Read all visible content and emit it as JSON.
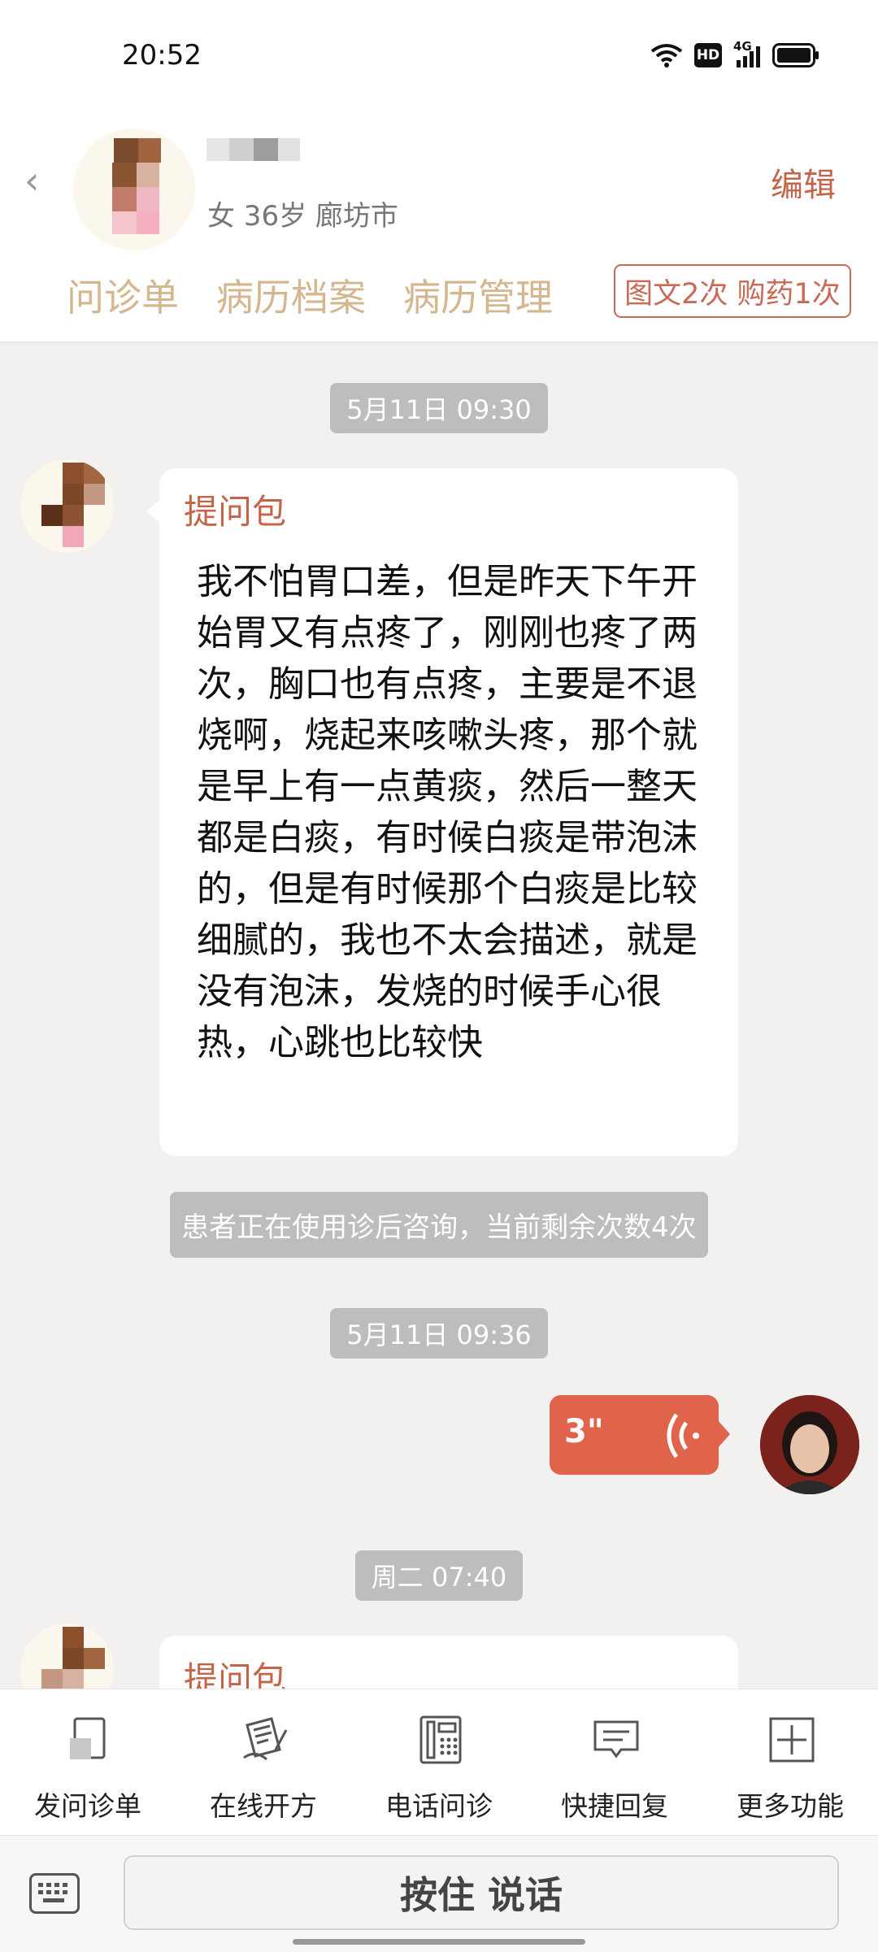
{
  "status_bar": {
    "time": "20:52",
    "hd": "HD",
    "network": "4G"
  },
  "header": {
    "patient_info": "女 36岁  廊坊市",
    "edit_label": "编辑",
    "tabs": [
      "问诊单",
      "病历档案",
      "病历管理"
    ],
    "service_badge": "图文2次 购药1次"
  },
  "chat": {
    "time1": "5月11日 09:30",
    "msg1_title": "提问包",
    "msg1_body": "我不怕胃口差，但是昨天下午开始胃又有点疼了，刚刚也疼了两次，胸口也有点疼，主要是不退烧啊，烧起来咳嗽头疼，那个就是早上有一点黄痰，然后一整天都是白痰，有时候白痰是带泡沫的，但是有时候那个白痰是比较细腻的，我也不太会描述，就是没有泡沫，发烧的时候手心很热，心跳也比较快",
    "system_notice": "患者正在使用诊后咨询，当前剩余次数4次",
    "time2": "5月11日 09:36",
    "voice_duration": "3\"",
    "time3": "周二 07:40",
    "msg2_title": "提问包"
  },
  "toolbar": {
    "items": [
      {
        "label": "发问诊单",
        "icon": "questionnaire-icon"
      },
      {
        "label": "在线开方",
        "icon": "prescription-icon"
      },
      {
        "label": "电话问诊",
        "icon": "phone-icon"
      },
      {
        "label": "快捷回复",
        "icon": "quick-reply-icon"
      },
      {
        "label": "更多功能",
        "icon": "plus-icon"
      }
    ]
  },
  "input": {
    "hold_to_talk": "按住 说话"
  },
  "colors": {
    "accent": "#c4654a",
    "voice_bubble": "#e0634c",
    "tab_text": "#d4b78f"
  }
}
